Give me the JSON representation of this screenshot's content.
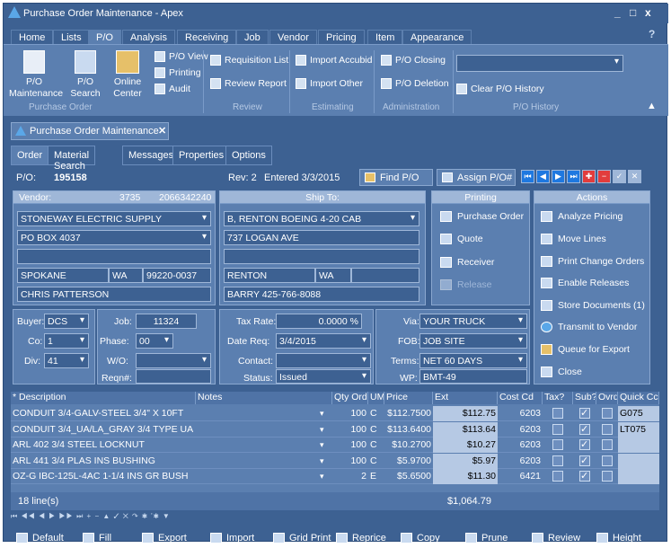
{
  "window": {
    "title": "Purchase Order Maintenance - Apex",
    "minimize": "_",
    "maximize": "□",
    "close": "x",
    "help": "?"
  },
  "menu": {
    "tabs": [
      "Home",
      "Lists",
      "P/O",
      "Analysis",
      "Receiving",
      "Job",
      "Vendor",
      "Pricing",
      "Item",
      "Appearance"
    ],
    "active": "P/O"
  },
  "ribbon": {
    "po_maintenance": "P/O Maintenance",
    "po_search": "P/O Search",
    "online_center": "Online Center",
    "po_view": "P/O View",
    "printing": "Printing",
    "audit": "Audit",
    "requisition_list": "Requisition List",
    "review_report": "Review Report",
    "import_accubid": "Import Accubid",
    "import_other": "Import Other",
    "po_closing": "P/O Closing",
    "po_deletion": "P/O Deletion",
    "clear_po_history": "Clear P/O History",
    "groups": [
      "Purchase Order",
      "Review",
      "Estimating",
      "Administration",
      "P/O History"
    ]
  },
  "doc_tab": {
    "label": "Purchase Order Maintenance",
    "close": "✕"
  },
  "subtabs": [
    "Order",
    "Material Search",
    "Messages",
    "Properties",
    "Options"
  ],
  "info": {
    "po_label": "P/O:",
    "po_number": "195158",
    "rev": "Rev: 2",
    "entered": "Entered  3/3/2015",
    "find_po": "Find P/O",
    "assign_po": "Assign P/O#"
  },
  "vendor": {
    "header": "Vendor:",
    "num": "3735",
    "phone": "2066342240",
    "name": "STONEWAY ELECTRIC SUPPLY",
    "addr1": "PO BOX 4037",
    "addr2": "",
    "city": "SPOKANE",
    "state": "WA",
    "zip": "99220-0037",
    "contact": "CHRIS PATTERSON"
  },
  "shipto": {
    "header": "Ship To:",
    "name": "B, RENTON BOEING 4-20 CAB",
    "addr1": "737 LOGAN AVE",
    "addr2": "",
    "city": "RENTON",
    "state": "WA",
    "zip": "",
    "contact": "BARRY 425-766-8088"
  },
  "printing": {
    "header": "Printing",
    "purchase_order": "Purchase Order",
    "quote": "Quote",
    "receiver": "Receiver",
    "release": "Release"
  },
  "actions": {
    "header": "Actions",
    "analyze_pricing": "Analyze Pricing",
    "move_lines": "Move Lines",
    "print_change_orders": "Print Change Orders",
    "enable_releases": "Enable Releases",
    "store_documents": "Store Documents (1)",
    "transmit_to_vendor": "Transmit to Vendor",
    "queue_for_export": "Queue for Export",
    "close": "Close"
  },
  "details": {
    "buyer_label": "Buyer:",
    "buyer": "DCS",
    "co_label": "Co:",
    "co": "1",
    "div_label": "Div:",
    "div": "41",
    "job_label": "Job:",
    "job": "11324",
    "phase_label": "Phase:",
    "phase": "00",
    "wo_label": "W/O:",
    "wo": "",
    "reqn_label": "Reqn#:",
    "reqn": "",
    "tax_label": "Tax Rate:",
    "tax": "0.0000 %",
    "datereq_label": "Date Req:",
    "datereq": "3/4/2015",
    "contact_label": "Contact:",
    "contact": "",
    "status_label": "Status:",
    "status": "Issued",
    "via_label": "Via:",
    "via": "YOUR TRUCK",
    "fob_label": "FOB:",
    "fob": "JOB SITE",
    "terms_label": "Terms:",
    "terms": "NET 60 DAYS",
    "wp_label": "WP:",
    "wp": "BMT-49"
  },
  "grid": {
    "headers": [
      "* Description",
      "Notes",
      "Qty Ord",
      "UM",
      "Price",
      "Ext",
      "Cost Cd",
      "Tax?",
      "Sub?",
      "Ovrd",
      "Quick Cc"
    ],
    "rows": [
      {
        "desc": "CONDUIT 3/4-GALV-STEEL 3/4\" X 10FT",
        "qty": "100",
        "um": "C",
        "price": "$112.7500",
        "ext": "$112.75",
        "cost": "6203",
        "sub": true,
        "quick": "G075"
      },
      {
        "desc": "CONDUIT 3/4_UA/LA_GRAY 3/4 TYPE UA",
        "qty": "100",
        "um": "C",
        "price": "$113.6400",
        "ext": "$113.64",
        "cost": "6203",
        "sub": true,
        "quick": "LT075"
      },
      {
        "desc": "ARL 402 3/4 STEEL LOCKNUT",
        "qty": "100",
        "um": "C",
        "price": "$10.2700",
        "ext": "$10.27",
        "cost": "6203",
        "sub": true,
        "quick": ""
      },
      {
        "desc": "ARL 441 3/4 PLAS INS BUSHING",
        "qty": "100",
        "um": "C",
        "price": "$5.9700",
        "ext": "$5.97",
        "cost": "6203",
        "sub": true,
        "quick": ""
      },
      {
        "desc": "OZ-G IBC-125L-4AC 1-1/4 INS GR BUSH",
        "qty": "2",
        "um": "E",
        "price": "$5.6500",
        "ext": "$11.30",
        "cost": "6421",
        "sub": true,
        "quick": ""
      }
    ],
    "line_count": "18 line(s)",
    "total": "$1,064.79"
  },
  "nav": "⏮ ◀◀ ◀ ▶ ▶▶ ⏭ + − ▲ ✓ ✕ ↷ ✱ '✱ ▼",
  "bottom": [
    "Default",
    "Fill",
    "Export",
    "Import",
    "Grid Print",
    "Reprice",
    "Copy",
    "Prune",
    "Review",
    "Height"
  ]
}
